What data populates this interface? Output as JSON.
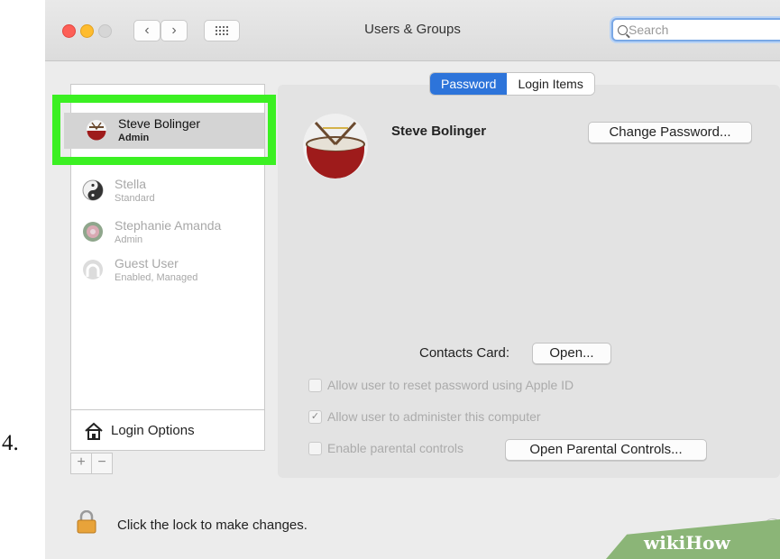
{
  "step_number": "4.",
  "window": {
    "title": "Users & Groups",
    "search_placeholder": "Search"
  },
  "users": [
    {
      "name": "Steve Bolinger",
      "role": "Admin",
      "selected": true
    },
    {
      "name": "Stella",
      "role": "Standard",
      "selected": false
    },
    {
      "name": "Stephanie Amanda",
      "role": "Admin",
      "selected": false
    },
    {
      "name": "Guest User",
      "role": "Enabled, Managed",
      "selected": false
    }
  ],
  "login_options_label": "Login Options",
  "add_label": "+",
  "remove_label": "−",
  "tabs": {
    "password": "Password",
    "login_items": "Login Items"
  },
  "main": {
    "full_name": "Steve Bolinger",
    "change_password_label": "Change Password...",
    "contacts_card_label": "Contacts Card:",
    "open_label": "Open...",
    "checkboxes": [
      {
        "label": "Allow user to reset password using Apple ID",
        "checked": false
      },
      {
        "label": "Allow user to administer this computer",
        "checked": true
      },
      {
        "label": "Enable parental controls",
        "checked": false
      }
    ],
    "open_parental_controls_label": "Open Parental Controls..."
  },
  "footer": {
    "lock_text": "Click the lock to make changes.",
    "help_label": "?"
  },
  "watermark": "wikiHow",
  "colors": {
    "accent": "#2d74da",
    "highlight": "#3bf022",
    "watermark": "#8bb577"
  }
}
